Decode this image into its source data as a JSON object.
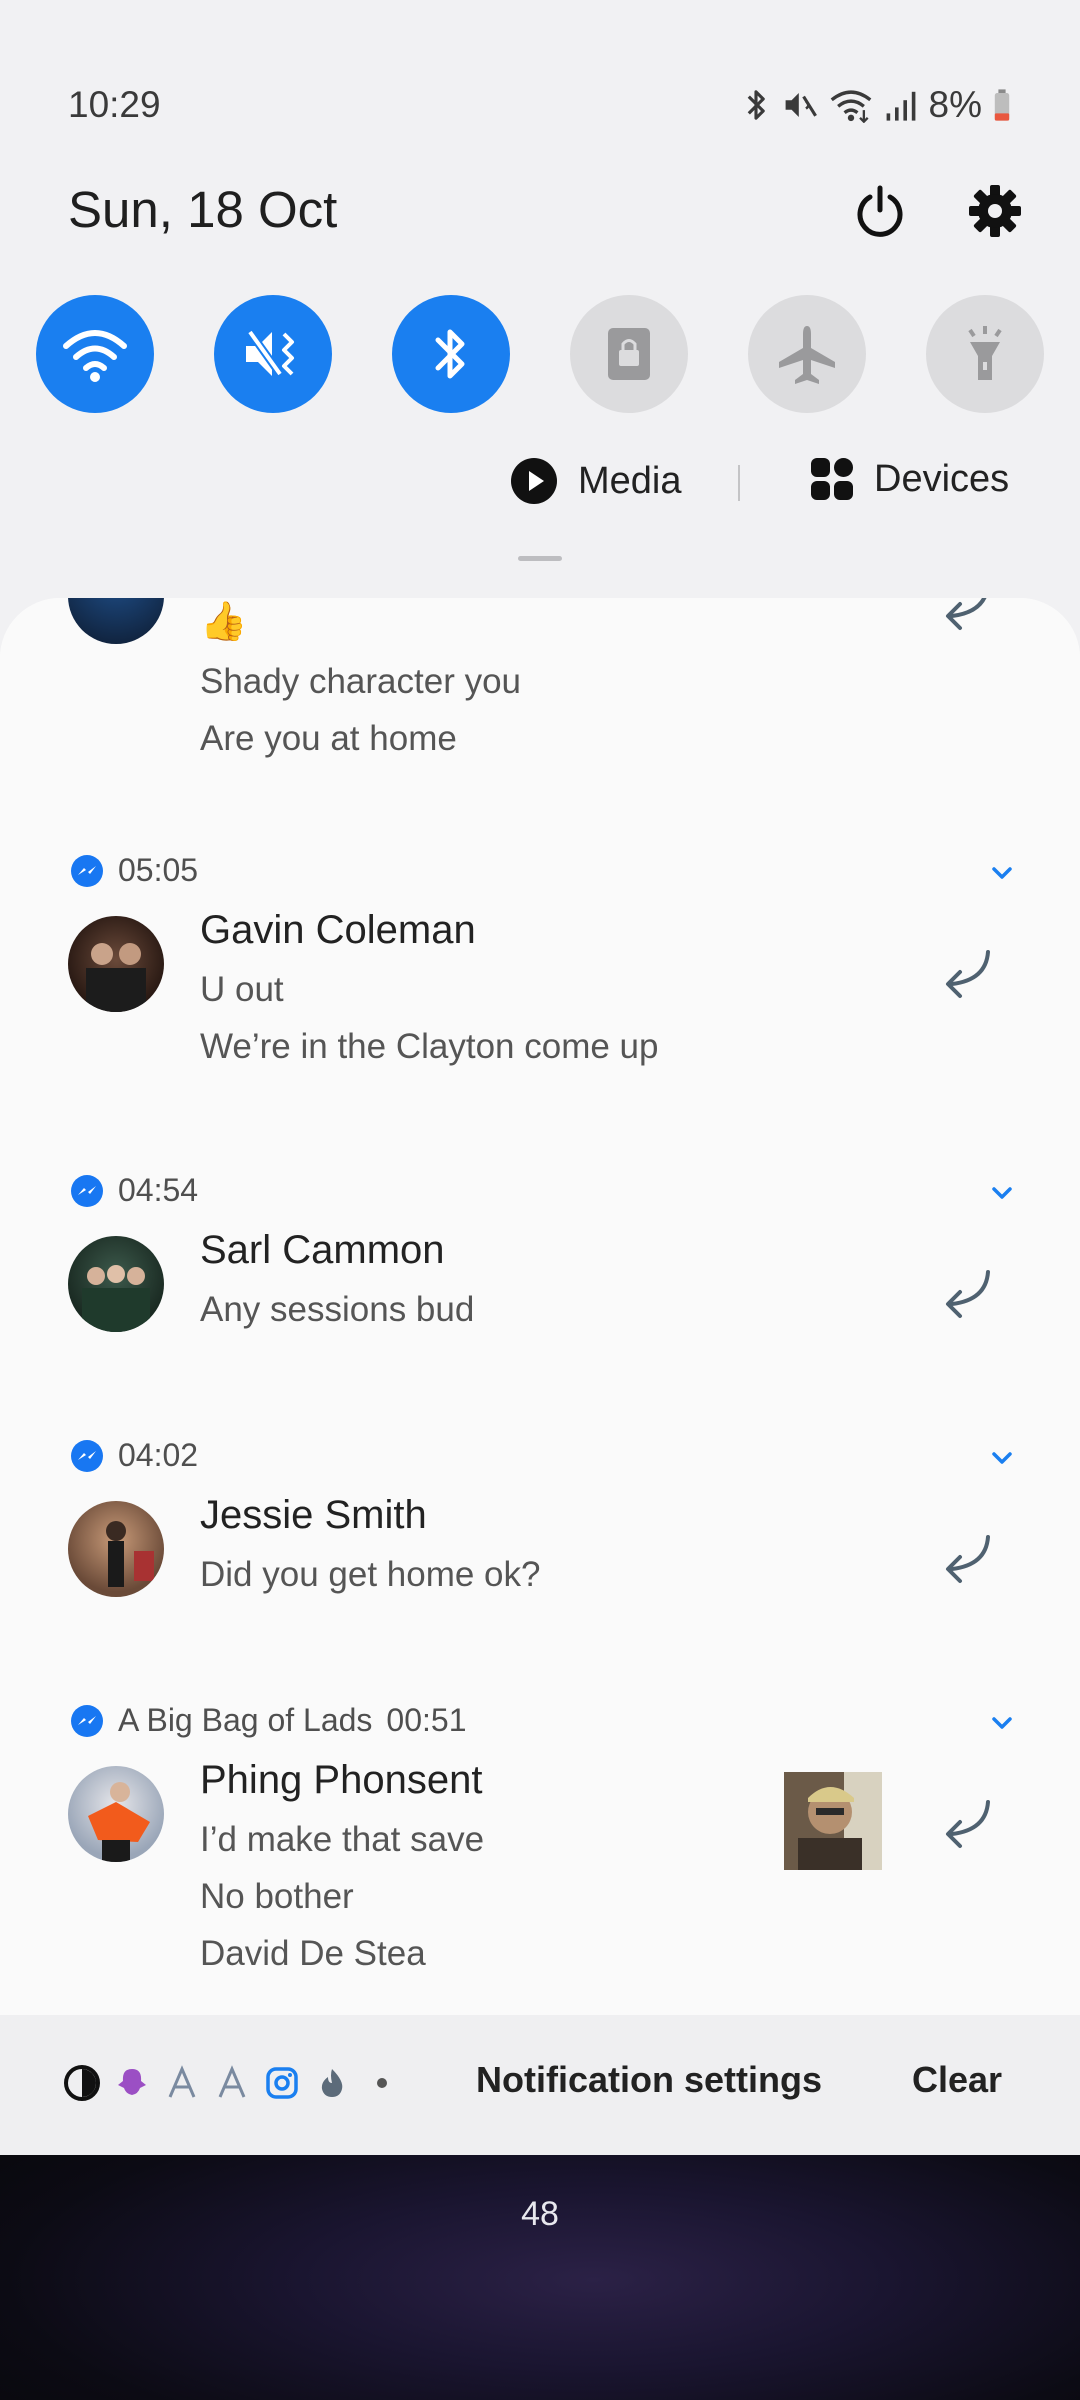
{
  "status_bar": {
    "time": "10:29",
    "battery": "8%"
  },
  "header": {
    "date": "Sun, 18 Oct"
  },
  "quick_tiles": [
    {
      "name": "wifi",
      "icon": "wifi-icon",
      "state": "on"
    },
    {
      "name": "sound",
      "icon": "mute-vibrate-icon",
      "state": "on"
    },
    {
      "name": "bluetooth",
      "icon": "bluetooth-icon",
      "state": "on"
    },
    {
      "name": "screen-lock",
      "icon": "lock-icon",
      "state": "off"
    },
    {
      "name": "airplane",
      "icon": "airplane-icon",
      "state": "off"
    },
    {
      "name": "flashlight",
      "icon": "flashlight-icon",
      "state": "off"
    }
  ],
  "media_row": {
    "media_label": "Media",
    "devices_label": "Devices"
  },
  "notifications": {
    "partial": {
      "emoji": "👍",
      "lines": [
        "Shady character you",
        "Are you at home"
      ]
    },
    "items": [
      {
        "time": "05:05",
        "sender": "Gavin Coleman",
        "lines": [
          "U out",
          "We’re in the Clayton come up"
        ]
      },
      {
        "time": "04:54",
        "sender": "Sarl Cammon",
        "lines": [
          "Any sessions bud"
        ]
      },
      {
        "time": "04:02",
        "sender": "Jessie Smith",
        "lines": [
          "Did you get home ok?"
        ]
      },
      {
        "group": "A Big Bag of Lads",
        "time": "00:51",
        "sender": "Phing Phonsent",
        "lines": [
          "I’d make that save",
          "No bother",
          "David De Stea"
        ]
      }
    ]
  },
  "footer": {
    "notification_settings": "Notification settings",
    "clear": "Clear"
  },
  "wallpaper": {
    "count": "48"
  },
  "colors": {
    "accent": "#1a7ff0",
    "messenger": "#1877f2"
  }
}
